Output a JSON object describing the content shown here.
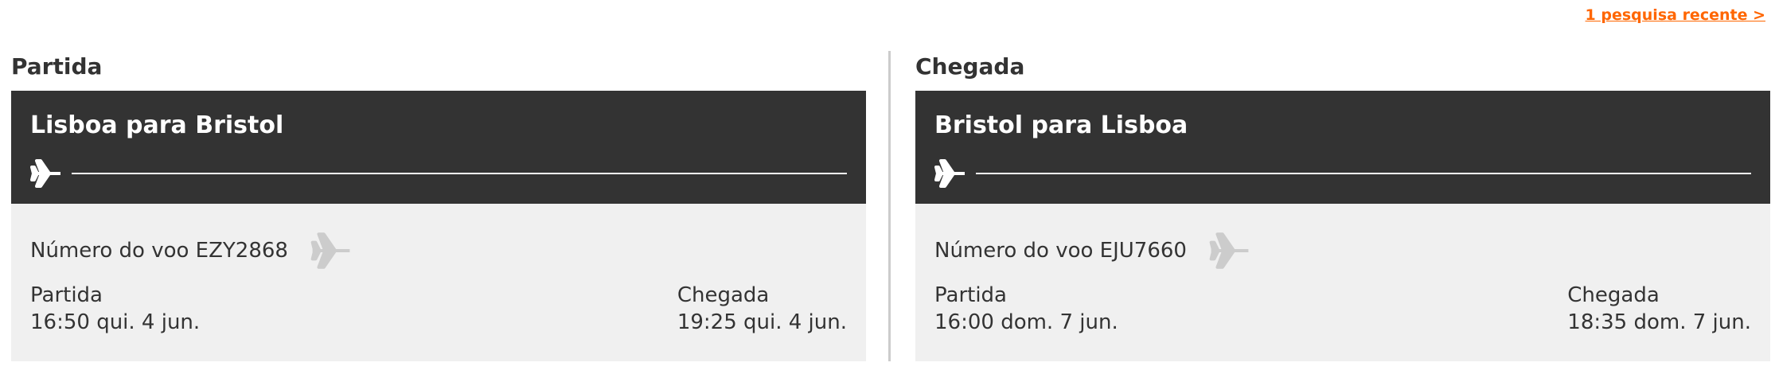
{
  "recent_search_link": "1 pesquisa recente >",
  "accent_color": "#ff6600",
  "header_bg_color": "#333333",
  "card_body_color": "#f0f0f0",
  "outbound": {
    "section_title": "Partida",
    "route_title": "Lisboa para Bristol",
    "route_icon": "airplane-icon",
    "flight_number": "Número do voo EZY2868",
    "flight_icon": "airplane-icon",
    "departure_label": "Partida",
    "departure_time": "16:50 qui. 4 jun.",
    "arrival_label": "Chegada",
    "arrival_time": "19:25 qui. 4 jun."
  },
  "return": {
    "section_title": "Chegada",
    "route_title": "Bristol para Lisboa",
    "route_icon": "airplane-icon",
    "flight_number": "Número do voo EJU7660",
    "flight_icon": "airplane-icon",
    "departure_label": "Partida",
    "departure_time": "16:00 dom. 7 jun.",
    "arrival_label": "Chegada",
    "arrival_time": "18:35 dom. 7 jun."
  }
}
